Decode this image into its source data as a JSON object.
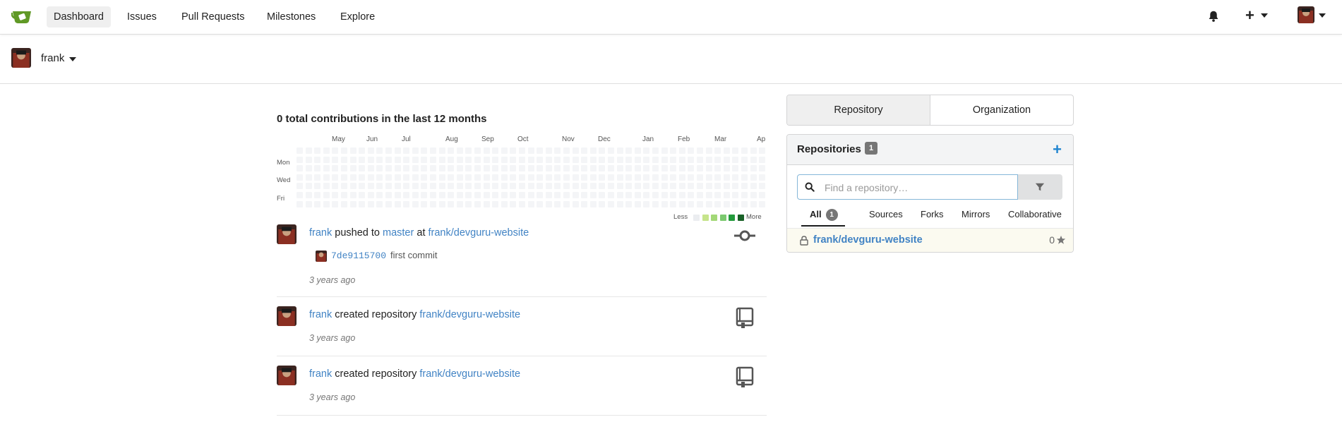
{
  "nav": {
    "items": [
      {
        "label": "Dashboard",
        "active": true
      },
      {
        "label": "Issues"
      },
      {
        "label": "Pull Requests"
      },
      {
        "label": "Milestones"
      },
      {
        "label": "Explore"
      }
    ],
    "plus": "+"
  },
  "context": {
    "username": "frank"
  },
  "heatmap": {
    "title": "0 total contributions in the last 12 months",
    "months": [
      "May",
      "Jun",
      "Jul",
      "Aug",
      "Sep",
      "Oct",
      "Nov",
      "Dec",
      "Jan",
      "Feb",
      "Mar",
      "Ap"
    ],
    "days": [
      "Mon",
      "Wed",
      "Fri"
    ],
    "legend_less": "Less",
    "legend_more": "More",
    "legend_colors": [
      "#ebedf0",
      "#c6e48b",
      "#a3d877",
      "#7bc96f",
      "#239a3b",
      "#196127"
    ]
  },
  "feed": [
    {
      "user": "frank",
      "action": "pushed to",
      "branch": "master",
      "at": "at",
      "repo": "frank/devguru-website",
      "commit_sha": "7de9115700",
      "commit_msg": "first commit",
      "time": "3 years ago",
      "icon": "git-commit-icon"
    },
    {
      "user": "frank",
      "action": "created repository",
      "repo": "frank/devguru-website",
      "time": "3 years ago",
      "icon": "repo-book-icon"
    },
    {
      "user": "frank",
      "action": "created repository",
      "repo": "frank/devguru-website",
      "time": "3 years ago",
      "icon": "repo-book-icon"
    }
  ],
  "sidebar": {
    "tabs": [
      {
        "label": "Repository"
      },
      {
        "label": "Organization"
      }
    ],
    "repos_title": "Repositories",
    "repos_count": "1",
    "add_label": "+",
    "search_placeholder": "Find a repository…",
    "subtabs": [
      {
        "label": "All",
        "badge": "1"
      },
      {
        "label": "Sources"
      },
      {
        "label": "Forks"
      },
      {
        "label": "Mirrors"
      },
      {
        "label": "Collaborative"
      }
    ],
    "repo_items": [
      {
        "name": "frank/devguru-website",
        "stars": "0",
        "private": true
      }
    ]
  }
}
